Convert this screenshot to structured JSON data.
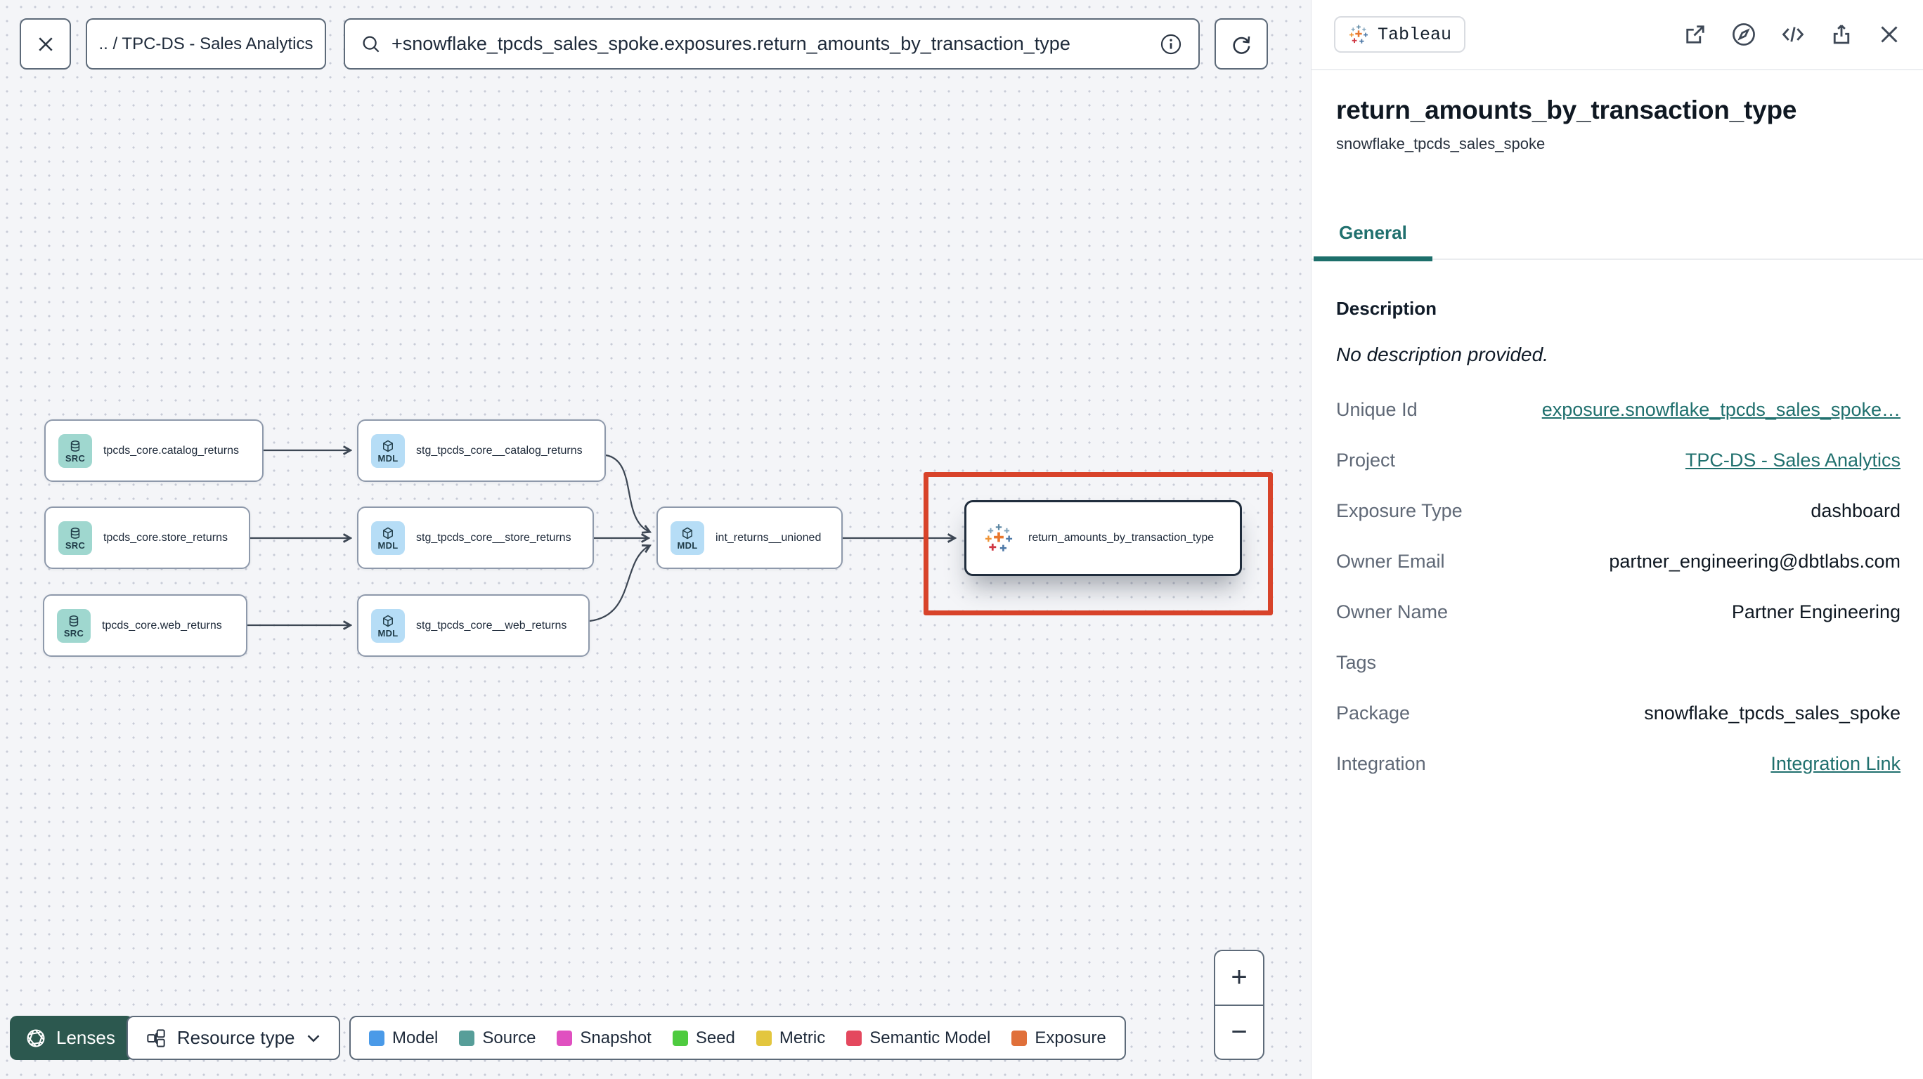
{
  "topbar": {
    "breadcrumb": ".. / TPC-DS - Sales Analytics",
    "search_value": "+snowflake_tpcds_sales_spoke.exposures.return_amounts_by_transaction_type"
  },
  "graph": {
    "nodes": [
      {
        "kind": "source",
        "badge": "SRC",
        "label": "tpcds_core.catalog_returns"
      },
      {
        "kind": "source",
        "badge": "SRC",
        "label": "tpcds_core.store_returns"
      },
      {
        "kind": "source",
        "badge": "SRC",
        "label": "tpcds_core.web_returns"
      },
      {
        "kind": "model",
        "badge": "MDL",
        "label": "stg_tpcds_core__catalog_returns"
      },
      {
        "kind": "model",
        "badge": "MDL",
        "label": "stg_tpcds_core__store_returns"
      },
      {
        "kind": "model",
        "badge": "MDL",
        "label": "stg_tpcds_core__web_returns"
      },
      {
        "kind": "model",
        "badge": "MDL",
        "label": "int_returns__unioned"
      },
      {
        "kind": "exposure",
        "badge": "",
        "label": "return_amounts_by_transaction_type",
        "selected": true
      }
    ]
  },
  "controls": {
    "lenses_label": "Lenses",
    "resource_type_label": "Resource type",
    "zoom_in_label": "+",
    "zoom_out_label": "−"
  },
  "legend": {
    "items": [
      {
        "label": "Model",
        "color": "#4a9ae8"
      },
      {
        "label": "Source",
        "color": "#579e99"
      },
      {
        "label": "Snapshot",
        "color": "#e050c0"
      },
      {
        "label": "Seed",
        "color": "#4ecb3f"
      },
      {
        "label": "Metric",
        "color": "#e3c63e"
      },
      {
        "label": "Semantic Model",
        "color": "#e4485e"
      },
      {
        "label": "Exposure",
        "color": "#e0703a"
      }
    ]
  },
  "panel": {
    "integration_badge": "Tableau",
    "title": "return_amounts_by_transaction_type",
    "subtitle": "snowflake_tpcds_sales_spoke",
    "tabs": [
      {
        "label": "General",
        "active": true
      }
    ],
    "description_label": "Description",
    "description_value": "No description provided.",
    "fields": [
      {
        "label": "Unique Id",
        "value": "exposure.snowflake_tpcds_sales_spoke…",
        "link": true
      },
      {
        "label": "Project",
        "value": "TPC-DS - Sales Analytics",
        "link": true
      },
      {
        "label": "Exposure Type",
        "value": "dashboard",
        "link": false
      },
      {
        "label": "Owner Email",
        "value": "partner_engineering@dbtlabs.com",
        "link": false
      },
      {
        "label": "Owner Name",
        "value": "Partner Engineering",
        "link": false
      },
      {
        "label": "Tags",
        "value": "",
        "link": false
      },
      {
        "label": "Package",
        "value": "snowflake_tpcds_sales_spoke",
        "link": false
      },
      {
        "label": "Integration",
        "value": "Integration Link",
        "link": true
      }
    ]
  },
  "colors": {
    "accent_teal": "#20706e",
    "selection_red": "#d8432a",
    "lenses_green": "#2c584f",
    "canvas_bg": "#f4f5f8"
  },
  "icons": {
    "close-icon": "✕",
    "search-icon": "magnifier",
    "info-icon": "ⓘ",
    "refresh-icon": "circular arrow",
    "tableau-logo-icon": "plus-sparkle mark",
    "external-link-icon": "box with outward arrow",
    "compass-icon": "circle with needle",
    "code-icon": "</>",
    "share-icon": "box with up arrow",
    "panel-close-icon": "✕",
    "database-icon": "cylinder (source)",
    "cube-icon": "package cube (model)",
    "aperture-icon": "camera shutter (lenses)",
    "resource-type-icon": "linked squares",
    "chevron-down-icon": "⌄",
    "zoom-in-icon": "+",
    "zoom-out-icon": "−"
  }
}
